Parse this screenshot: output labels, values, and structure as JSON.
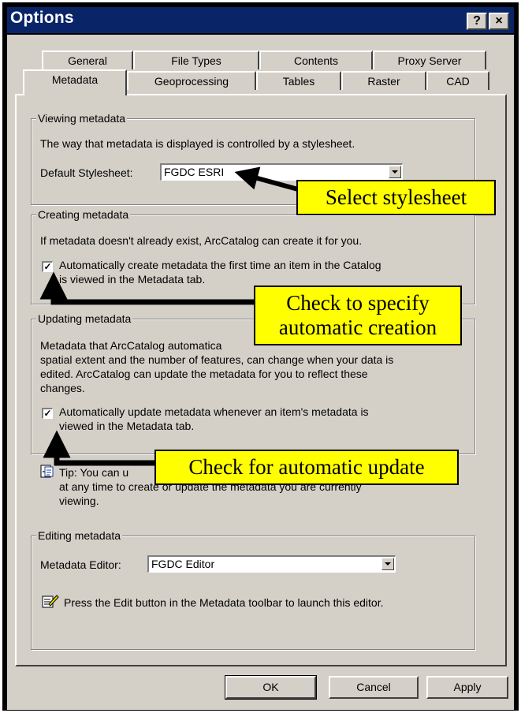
{
  "window": {
    "title": "Options",
    "help_btn": "?",
    "close_btn": "×"
  },
  "tabs": {
    "row1": [
      "General",
      "File Types",
      "Contents",
      "Proxy Server"
    ],
    "row2": [
      "Metadata",
      "Geoprocessing",
      "Tables",
      "Raster",
      "CAD"
    ],
    "active": "Metadata"
  },
  "viewing": {
    "legend": "Viewing metadata",
    "desc": "The way that metadata is displayed is controlled by a stylesheet.",
    "label": "Default Stylesheet:",
    "value": "FGDC ESRI"
  },
  "creating": {
    "legend": "Creating metadata",
    "desc": "If metadata doesn't already exist, ArcCatalog can create it for you.",
    "check_line1": "Automatically create metadata the first time an item in the Catalog",
    "check_line2": "is viewed in the Metadata tab.",
    "checked": true
  },
  "updating": {
    "legend": "Updating metadata",
    "desc_line1": "Metadata that ArcCatalog automatica",
    "desc_line2": "spatial extent and the number of features, can change when your data is",
    "desc_line3": "edited.  ArcCatalog can update the metadata for you to reflect these",
    "desc_line4": "changes.",
    "check_line1": "Automatically update metadata whenever an item's metadata is",
    "check_line2": "viewed in the Metadata tab.",
    "checked": true
  },
  "tip": {
    "line1": "Tip: You can u",
    "line2": "at any time to create or update the metadata you are currently",
    "line3": "viewing."
  },
  "editing": {
    "legend": "Editing metadata",
    "label": "Metadata Editor:",
    "value": "FGDC Editor",
    "note": "Press the Edit button in the Metadata toolbar to launch this editor."
  },
  "buttons": {
    "ok": "OK",
    "cancel": "Cancel",
    "apply": "Apply"
  },
  "callouts": {
    "stylesheet": "Select stylesheet",
    "creation_line1": "Check to specify",
    "creation_line2": "automatic creation",
    "update": "Check for automatic update"
  },
  "colors": {
    "titlebar": "#0a2468",
    "dialog": "#d4d0c8",
    "callout": "#ffff00"
  }
}
